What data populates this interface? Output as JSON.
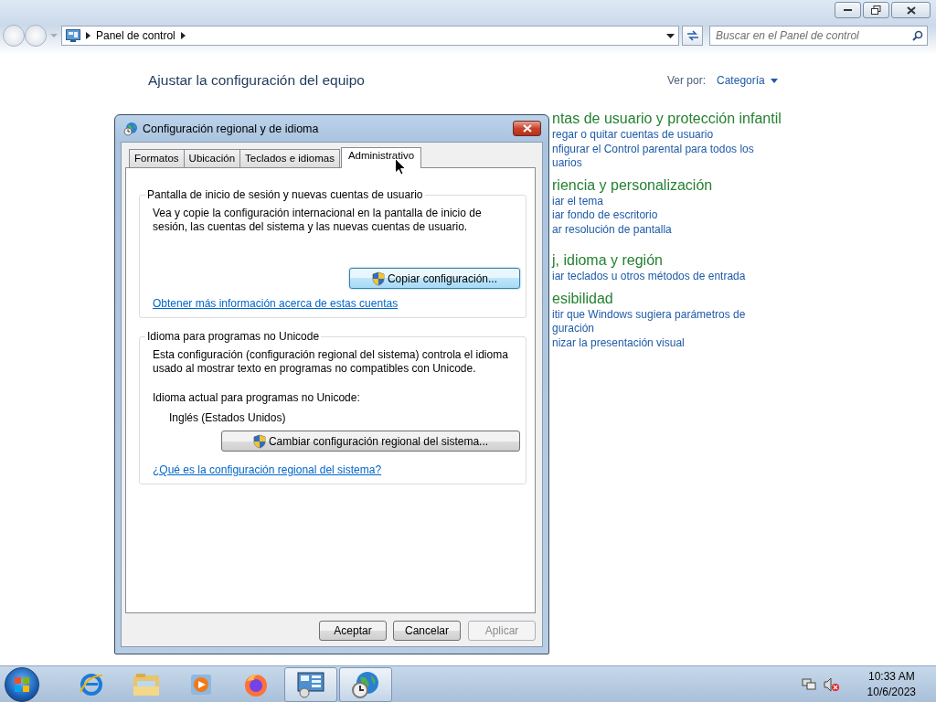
{
  "explorer": {
    "address": {
      "crumbs": [
        "Panel de control"
      ]
    },
    "search": {
      "placeholder": "Buscar en el Panel de control"
    },
    "heading": "Ajustar la configuración del equipo",
    "view_by": {
      "label": "Ver por:",
      "value": "Categoría"
    },
    "categories": [
      {
        "title": "ntas de usuario y protección infantil",
        "links": [
          "regar o quitar cuentas de usuario",
          "nfigurar el Control parental para todos los\nuarios"
        ]
      },
      {
        "title": "riencia y personalización",
        "links": [
          "iar el tema",
          "iar fondo de escritorio",
          "ar resolución de pantalla"
        ]
      },
      {
        "title": "j, idioma y región",
        "links": [
          "iar teclados u otros métodos de entrada"
        ]
      },
      {
        "title": "esibilidad",
        "links": [
          "itir que Windows sugiera parámetros de\nguración",
          "nizar la presentación visual"
        ]
      }
    ]
  },
  "dialog": {
    "title": "Configuración regional y de idioma",
    "tabs": [
      {
        "label": "Formatos",
        "selected": false
      },
      {
        "label": "Ubicación",
        "selected": false
      },
      {
        "label": "Teclados e idiomas",
        "selected": false
      },
      {
        "label": "Administrativo",
        "selected": true
      }
    ],
    "groups": [
      {
        "title": "Pantalla de inicio de sesión y nuevas cuentas de usuario",
        "description": "Vea y copie la configuración internacional en la pantalla de inicio de\nsesión, las cuentas del sistema y las nuevas cuentas de usuario.",
        "button": "Copiar configuración...",
        "link": "Obtener más información acerca de estas cuentas"
      },
      {
        "title": "Idioma para programas no Unicode",
        "description": "Esta configuración (configuración regional del sistema) controla el idioma\nusado al mostrar texto en programas no compatibles con Unicode.",
        "current_label": "Idioma actual para programas no Unicode:",
        "current_value": "Inglés (Estados Unidos)",
        "button": "Cambiar configuración regional del sistema...",
        "link": "¿Qué es la configuración regional del sistema?"
      }
    ],
    "buttons": [
      {
        "label": "Aceptar",
        "disabled": false
      },
      {
        "label": "Cancelar",
        "disabled": false
      },
      {
        "label": "Aplicar",
        "disabled": true
      }
    ]
  },
  "taskbar": {
    "apps": [
      {
        "kind": "browser",
        "open": false
      },
      {
        "kind": "folder",
        "open": false
      },
      {
        "kind": "media",
        "open": false
      },
      {
        "kind": "firefox",
        "open": false
      },
      {
        "kind": "panel",
        "open": true
      },
      {
        "kind": "globe",
        "open": true
      }
    ],
    "time": "10:33 AM",
    "date": "10/6/2023"
  }
}
